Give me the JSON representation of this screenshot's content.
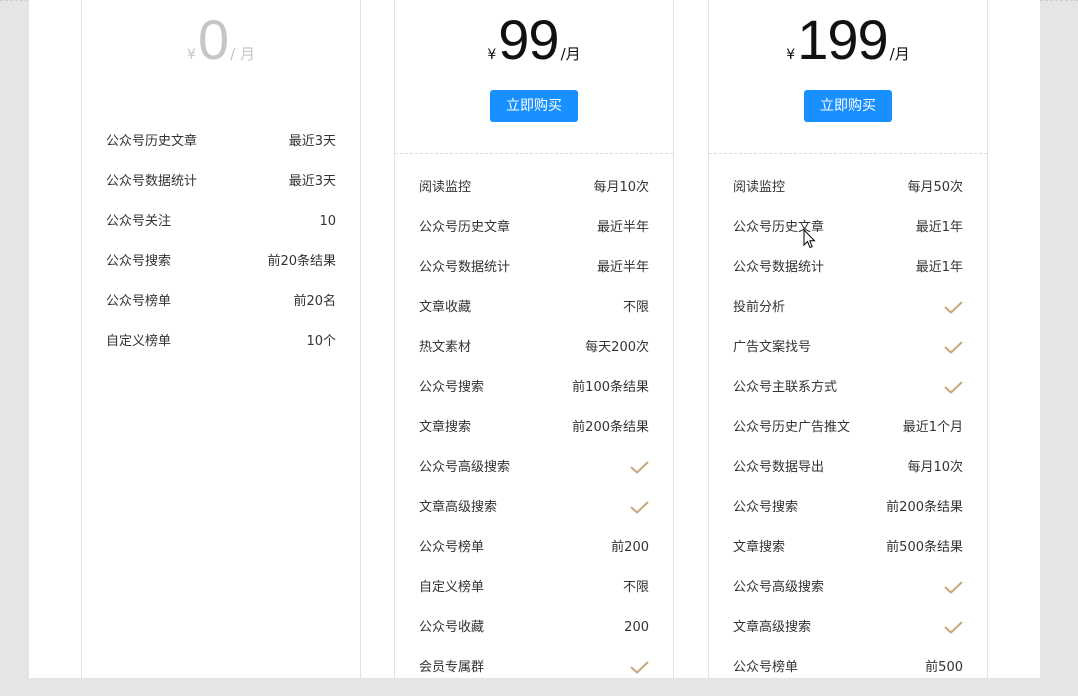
{
  "colors": {
    "primary": "#1890ff",
    "check": "#c9a77c",
    "free_price": "#c6c6c6"
  },
  "plans": [
    {
      "currency": "¥",
      "amount": "0",
      "period": "/ 月",
      "features": [
        {
          "label": "公众号历史文章",
          "value": "最近3天"
        },
        {
          "label": "公众号数据统计",
          "value": "最近3天"
        },
        {
          "label": "公众号关注",
          "value": "10"
        },
        {
          "label": "公众号搜索",
          "value": "前20条结果"
        },
        {
          "label": "公众号榜单",
          "value": "前20名"
        },
        {
          "label": "自定义榜单",
          "value": "10个"
        }
      ]
    },
    {
      "currency": "¥",
      "amount": "99",
      "period": "/月",
      "buy_label": "立即购买",
      "features": [
        {
          "label": "阅读监控",
          "value": "每月10次"
        },
        {
          "label": "公众号历史文章",
          "value": "最近半年"
        },
        {
          "label": "公众号数据统计",
          "value": "最近半年"
        },
        {
          "label": "文章收藏",
          "value": "不限"
        },
        {
          "label": "热文素材",
          "value": "每天200次"
        },
        {
          "label": "公众号搜索",
          "value": "前100条结果"
        },
        {
          "label": "文章搜索",
          "value": "前200条结果"
        },
        {
          "label": "公众号高级搜索",
          "check": true
        },
        {
          "label": "文章高级搜索",
          "check": true
        },
        {
          "label": "公众号榜单",
          "value": "前200"
        },
        {
          "label": "自定义榜单",
          "value": "不限"
        },
        {
          "label": "公众号收藏",
          "value": "200"
        },
        {
          "label": "会员专属群",
          "check": true
        }
      ]
    },
    {
      "currency": "¥",
      "amount": "199",
      "period": "/月",
      "buy_label": "立即购买",
      "features": [
        {
          "label": "阅读监控",
          "value": "每月50次"
        },
        {
          "label": "公众号历史文章",
          "value": "最近1年"
        },
        {
          "label": "公众号数据统计",
          "value": "最近1年"
        },
        {
          "label": "投前分析",
          "check": true
        },
        {
          "label": "广告文案找号",
          "check": true
        },
        {
          "label": "公众号主联系方式",
          "check": true
        },
        {
          "label": "公众号历史广告推文",
          "value": "最近1个月"
        },
        {
          "label": "公众号数据导出",
          "value": "每月10次"
        },
        {
          "label": "公众号搜索",
          "value": "前200条结果"
        },
        {
          "label": "文章搜索",
          "value": "前500条结果"
        },
        {
          "label": "公众号高级搜索",
          "check": true
        },
        {
          "label": "文章高级搜索",
          "check": true
        },
        {
          "label": "公众号榜单",
          "value": "前500"
        }
      ]
    }
  ]
}
